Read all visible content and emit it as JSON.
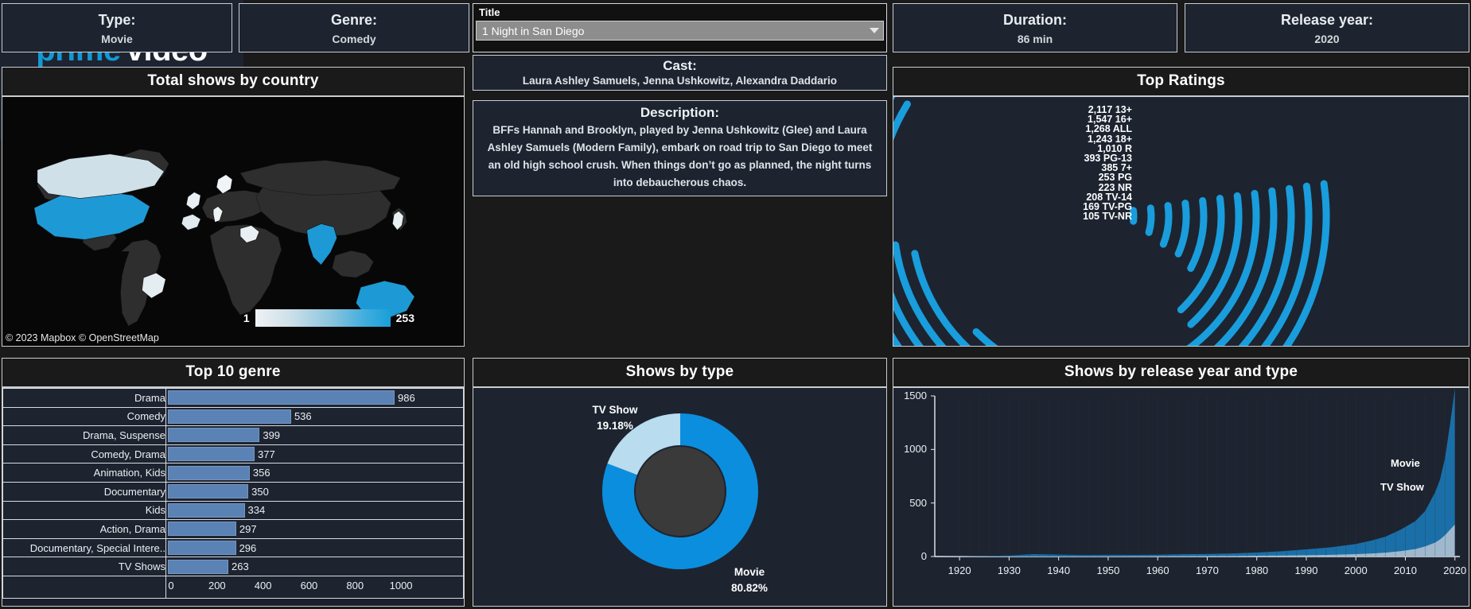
{
  "kpis": [
    {
      "label": "Type:",
      "value": "Movie"
    },
    {
      "label": "Genre:",
      "value": "Comedy"
    },
    {
      "label": "Duration:",
      "value": "86 min"
    },
    {
      "label": "Release year:",
      "value": "2020"
    }
  ],
  "title_filter": {
    "label": "Title",
    "selected": "1 Night in San Diego",
    "caret_icon": "chevron-down-icon"
  },
  "cast": {
    "heading": "Cast:",
    "value": "Laura Ashley Samuels, Jenna Ushkowitz, Alexandra Daddario"
  },
  "description": {
    "heading": "Description:",
    "value": "BFFs Hannah and Brooklyn, played by Jenna Ushkowitz (Glee) and Laura Ashley Samuels (Modern Family), embark on road trip to San Diego to meet an old high school crush. When things don’t go as planned, the night turns into debaucherous chaos."
  },
  "logo": {
    "word1": "prime",
    "word2": "video",
    "accent": "#1399d6"
  },
  "map": {
    "title": "Total shows by country",
    "attribution": "© 2023 Mapbox  © OpenStreetMap",
    "legend_min": "1",
    "legend_max": "253"
  },
  "chart_data": [
    {
      "type": "bar",
      "title": "Top Ratings",
      "orientation": "radial-horizontal",
      "categories": [
        "13+",
        "16+",
        "ALL",
        "18+",
        "R",
        "PG-13",
        "7+",
        "PG",
        "NR",
        "TV-14",
        "TV-PG",
        "TV-NR"
      ],
      "values": [
        2117,
        1547,
        1268,
        1243,
        1010,
        393,
        385,
        253,
        223,
        208,
        169,
        105
      ],
      "labels": [
        "2,117 13+",
        "1,547 16+",
        "1,268 ALL",
        "1,243 18+",
        "1,010 R",
        "393 PG-13",
        "385 7+",
        "253 PG",
        "223 NR",
        "208 TV-14",
        "169 TV-PG",
        "105 TV-NR"
      ],
      "color": "#199ddc",
      "xlabel": "",
      "ylabel": "",
      "legend": false,
      "grid": false
    },
    {
      "type": "bar",
      "title": "Top 10 genre",
      "orientation": "horizontal",
      "categories": [
        "Drama",
        "Comedy",
        "Drama, Suspense",
        "Comedy, Drama",
        "Animation, Kids",
        "Documentary",
        "Kids",
        "Action, Drama",
        "Documentary, Special Intere..",
        "TV Shows"
      ],
      "values": [
        986,
        536,
        399,
        377,
        356,
        350,
        334,
        297,
        296,
        263
      ],
      "xticks": [
        "0",
        "200",
        "400",
        "600",
        "800",
        "1000"
      ],
      "xlim": [
        0,
        1100
      ],
      "color": "#5b82b4",
      "xlabel": "",
      "ylabel": "",
      "legend": false,
      "grid": false
    },
    {
      "type": "pie",
      "subtype": "donut",
      "title": "Shows by type",
      "categories": [
        "Movie",
        "TV Show"
      ],
      "values": [
        80.82,
        19.18
      ],
      "value_labels": [
        "80.82%",
        "19.18%"
      ],
      "colors": [
        "#0b8ede",
        "#b9dcef"
      ],
      "legend": false
    },
    {
      "type": "area",
      "subtype": "stacked",
      "title": "Shows by release year and type",
      "xlabel": "",
      "ylabel": "",
      "xticks": [
        "1920",
        "1930",
        "1940",
        "1950",
        "1960",
        "1970",
        "1980",
        "1990",
        "2000",
        "2010",
        "2020"
      ],
      "yticks": [
        "0",
        "500",
        "1000",
        "1500"
      ],
      "xlim": [
        1915,
        2021
      ],
      "ylim": [
        0,
        1500
      ],
      "grid": false,
      "series": [
        {
          "name": "Movie",
          "color": "#1a6fa8",
          "x": [
            1915,
            1920,
            1925,
            1930,
            1935,
            1940,
            1945,
            1950,
            1955,
            1960,
            1965,
            1970,
            1975,
            1980,
            1985,
            1990,
            1995,
            2000,
            2003,
            2006,
            2009,
            2012,
            2014,
            2016,
            2017,
            2018,
            2019,
            2020
          ],
          "values": [
            0,
            2,
            5,
            10,
            22,
            18,
            14,
            16,
            14,
            15,
            18,
            20,
            24,
            30,
            40,
            55,
            70,
            95,
            120,
            150,
            200,
            260,
            330,
            470,
            560,
            720,
            980,
            1270
          ]
        },
        {
          "name": "TV Show",
          "color": "#9fb8cd",
          "x": [
            1915,
            1920,
            1925,
            1930,
            1935,
            1940,
            1945,
            1950,
            1955,
            1960,
            1965,
            1970,
            1975,
            1980,
            1985,
            1990,
            1995,
            2000,
            2003,
            2006,
            2009,
            2012,
            2014,
            2016,
            2017,
            2018,
            2019,
            2020
          ],
          "values": [
            0,
            0,
            0,
            0,
            0,
            0,
            0,
            0,
            1,
            2,
            3,
            4,
            5,
            7,
            9,
            12,
            16,
            22,
            28,
            36,
            50,
            70,
            95,
            130,
            160,
            200,
            250,
            300
          ]
        }
      ]
    }
  ],
  "panel_titles": {
    "map": "Total shows by country",
    "ratings": "Top Ratings",
    "genre": "Top 10 genre",
    "type": "Shows by type",
    "year": "Shows by release year and type"
  }
}
